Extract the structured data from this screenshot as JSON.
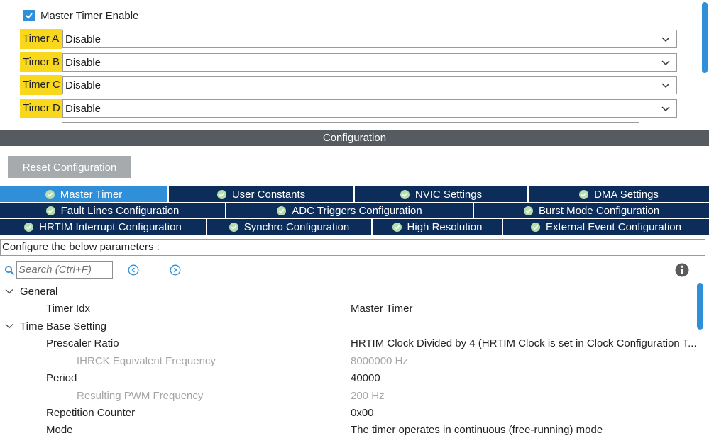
{
  "mode": {
    "master_enable_label": "Master Timer Enable",
    "master_enable_checked": true,
    "timers": [
      {
        "label": "Timer A",
        "value": "Disable"
      },
      {
        "label": "Timer B",
        "value": "Disable"
      },
      {
        "label": "Timer C",
        "value": "Disable"
      },
      {
        "label": "Timer D",
        "value": "Disable"
      }
    ]
  },
  "configuration": {
    "header": "Configuration",
    "reset_button": "Reset Configuration",
    "tabs_row1": [
      "Master Timer",
      "User Constants",
      "NVIC Settings",
      "DMA Settings"
    ],
    "tabs_row2": [
      "Fault Lines Configuration",
      "ADC Triggers Configuration",
      "Burst Mode Configuration"
    ],
    "tabs_row3": [
      "HRTIM Interrupt Configuration",
      "Synchro Configuration",
      "High Resolution",
      "External Event Configuration"
    ],
    "active_tab": "Master Timer",
    "params_label": "Configure the below parameters :",
    "search_placeholder": "Search (Ctrl+F)"
  },
  "tree": {
    "general": {
      "title": "General",
      "timer_idx": {
        "label": "Timer Idx",
        "value": "Master Timer"
      }
    },
    "time_base": {
      "title": "Time Base Setting",
      "prescaler": {
        "label": "Prescaler Ratio",
        "value": "HRTIM Clock Divided by 4 (HRTIM Clock is set in Clock Configuration T..."
      },
      "fhrck": {
        "label": "fHRCK Equivalent Frequency",
        "value": "8000000 Hz"
      },
      "period": {
        "label": "Period",
        "value": "40000"
      },
      "pwm_freq": {
        "label": "Resulting PWM Frequency",
        "value": "200 Hz"
      },
      "repetition": {
        "label": "Repetition Counter",
        "value": "0x00"
      },
      "mode": {
        "label": "Mode",
        "value": "The timer operates in continuous (free-running) mode"
      }
    }
  },
  "colors": {
    "accent": "#2f8fd8",
    "tab_bg": "#0c2d5a",
    "highlight": "#f9d71c",
    "header_bg": "#555b60"
  }
}
